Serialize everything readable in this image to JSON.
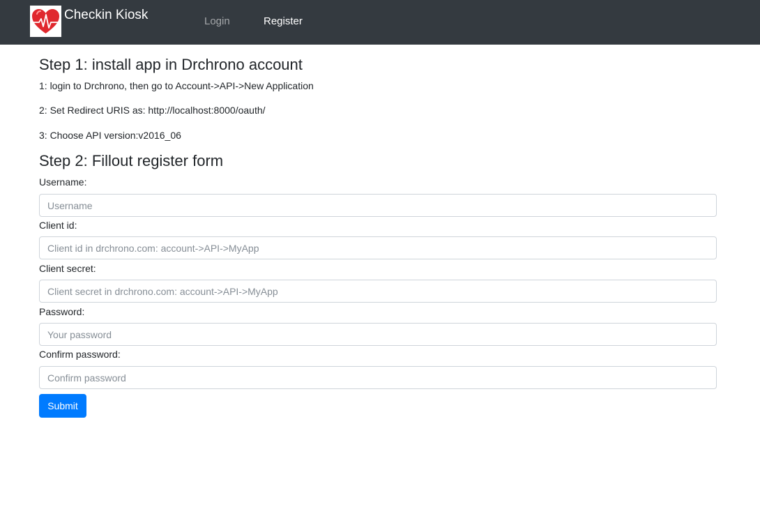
{
  "navbar": {
    "brand": "Checkin Kiosk",
    "logo_icon": "heart-pulse-icon",
    "links": [
      {
        "label": "Login",
        "active": false
      },
      {
        "label": "Register",
        "active": true
      }
    ]
  },
  "step1": {
    "title": "Step 1: install app in Drchrono account",
    "instructions": [
      "1: login to Drchrono, then go to Account->API->New Application",
      "2: Set Redirect URIS as: http://localhost:8000/oauth/",
      "3: Choose API version:v2016_06"
    ]
  },
  "step2": {
    "title": "Step 2: Fillout register form",
    "fields": {
      "username": {
        "label": "Username:",
        "placeholder": "Username",
        "value": ""
      },
      "client_id": {
        "label": "Client id:",
        "placeholder": "Client id in drchrono.com: account->API->MyApp",
        "value": ""
      },
      "client_secret": {
        "label": "Client secret:",
        "placeholder": "Client secret in drchrono.com: account->API->MyApp",
        "value": ""
      },
      "password": {
        "label": "Password:",
        "placeholder": "Your password",
        "value": ""
      },
      "confirm_password": {
        "label": "Confirm password:",
        "placeholder": "Confirm password",
        "value": ""
      }
    },
    "submit_label": "Submit"
  },
  "colors": {
    "navbar_bg": "#343a40",
    "primary": "#007bff",
    "heart": "#e0282e"
  }
}
